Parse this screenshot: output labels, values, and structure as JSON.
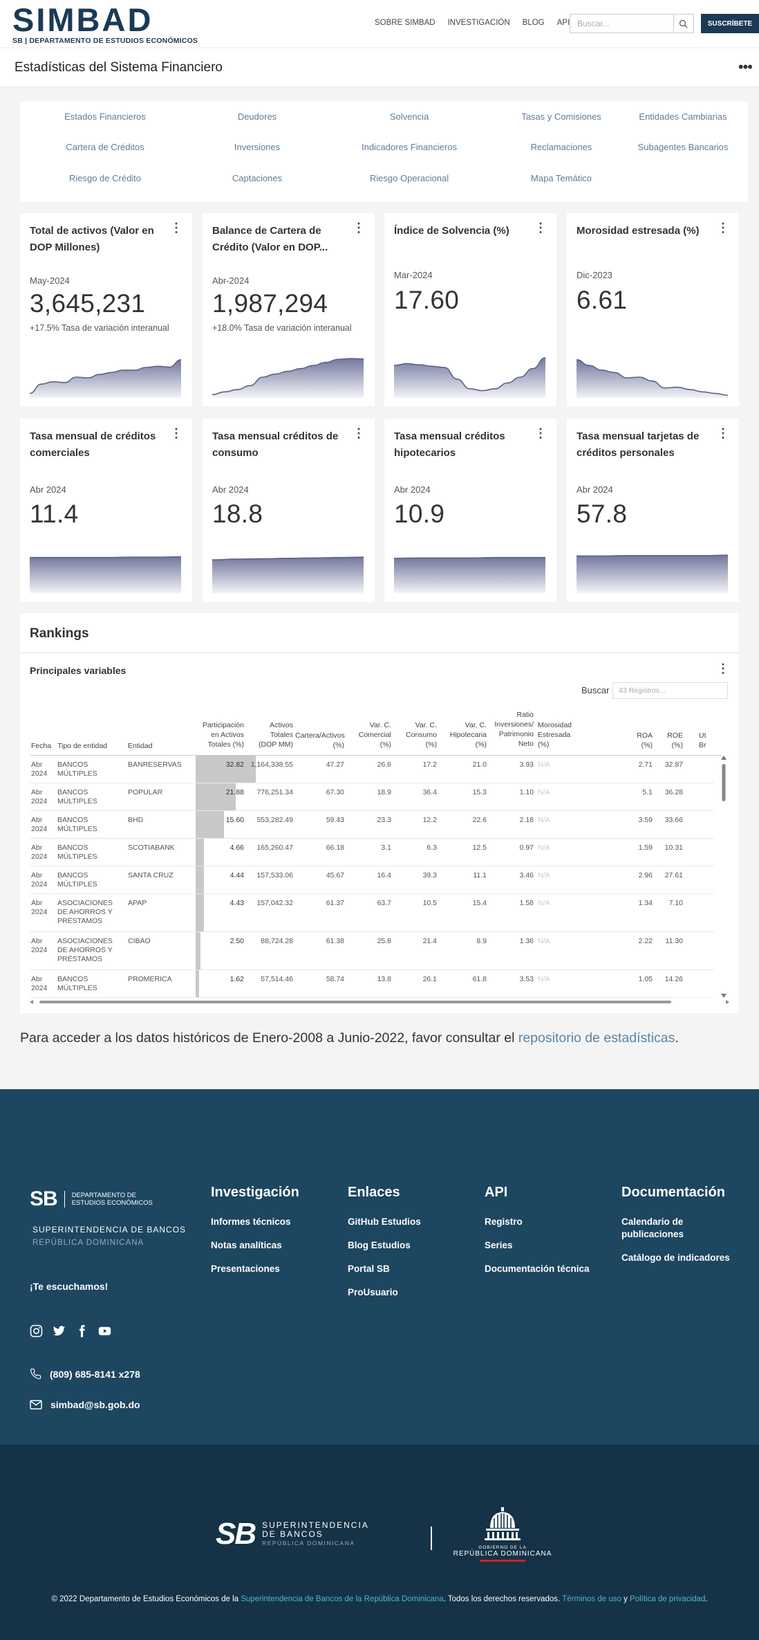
{
  "header": {
    "logo_text": "SIMBAD",
    "logo_mark": "SB",
    "logo_sub": "DEPARTAMENTO DE ESTUDIOS ECONÓMICOS",
    "nav": [
      "SOBRE SIMBAD",
      "INVESTIGACIÓN",
      "BLOG",
      "API"
    ],
    "search_placeholder": "Buscar...",
    "subscribe_label": "SUSCRÍBETE"
  },
  "page": {
    "title": "Estadísticas del Sistema Financiero",
    "more_icon": "more-dots-icon"
  },
  "categories": [
    "Estados Financieros",
    "Deudores",
    "Solvencia",
    "Tasas y Comisiones",
    "Entidades Cambiarias",
    "Cartera de Créditos",
    "Inversiones",
    "Indicadores Financieros",
    "Reclamaciones",
    "Subagentes Bancarios",
    "Riesgo de Crédito",
    "Captaciones",
    "Riesgo Operacional",
    "Mapa Temático"
  ],
  "cards_row1": [
    {
      "title": "Total de activos (Valor en DOP Millones)",
      "date": "May-2024",
      "value": "3,645,231",
      "sub": "+17.5% Tasa de variación interanual",
      "trend": [
        0.08,
        0.32,
        0.38,
        0.36,
        0.5,
        0.48,
        0.57,
        0.62,
        0.68,
        0.68,
        0.75,
        0.78,
        0.76,
        0.95
      ]
    },
    {
      "title": "Balance de Cartera de Crédito (Valor en DOP...",
      "date": "Abr-2024",
      "value": "1,987,294",
      "sub": "+18.0% Tasa de variación interanual",
      "trend": [
        0.05,
        0.12,
        0.18,
        0.28,
        0.5,
        0.58,
        0.65,
        0.72,
        0.8,
        0.88,
        0.96,
        0.98,
        0.97
      ]
    },
    {
      "title": "Índice de Solvencia (%)",
      "date": "Mar-2024",
      "value": "17.60",
      "sub": "",
      "trend": [
        0.8,
        0.85,
        0.82,
        0.78,
        0.75,
        0.45,
        0.2,
        0.15,
        0.2,
        0.35,
        0.5,
        0.72,
        1.0
      ]
    },
    {
      "title": "Morosidad estresada (%)",
      "date": "Dic-2023",
      "value": "6.61",
      "sub": "",
      "trend": [
        0.95,
        0.8,
        0.68,
        0.62,
        0.48,
        0.5,
        0.4,
        0.22,
        0.24,
        0.18,
        0.12,
        0.08,
        0.03
      ]
    }
  ],
  "cards_row2": [
    {
      "title": "Tasa mensual de créditos comerciales",
      "date": "Abr 2024",
      "value": "11.4",
      "trend": [
        0.88,
        0.88,
        0.88,
        0.88,
        0.89,
        0.89,
        0.9
      ]
    },
    {
      "title": "Tasa mensual créditos de consumo",
      "date": "Abr 2024",
      "value": "18.8",
      "trend": [
        0.82,
        0.84,
        0.85,
        0.86,
        0.87,
        0.88,
        0.89
      ]
    },
    {
      "title": "Tasa mensual créditos hipotecarios",
      "date": "Abr 2024",
      "value": "10.9",
      "trend": [
        0.86,
        0.87,
        0.87,
        0.87,
        0.88,
        0.88,
        0.88
      ]
    },
    {
      "title": "Tasa mensual tarjetas de créditos personales",
      "date": "Abr 2024",
      "value": "57.8",
      "trend": [
        0.92,
        0.92,
        0.93,
        0.93,
        0.93,
        0.93,
        0.94
      ]
    }
  ],
  "rankings": {
    "title": "Rankings",
    "subtitle": "Principales variables",
    "search_label": "Buscar",
    "search_placeholder": "43 Registros...",
    "columns": [
      "Fecha",
      "Tipo de entidad",
      "Entidad",
      "Participación en Activos Totales (%)",
      "Activos Totales (DOP MM)",
      "Cartera/Activos (%)",
      "Var. C. Comercial (%)",
      "Var. C. Consumo (%)",
      "Var. C. Hipotecaria (%)",
      "Ratio Inversiones/ Patrimonio Neto",
      "Morosidad Estresada (%)",
      "ROA (%)",
      "ROE (%)",
      "Ut Br"
    ],
    "rows": [
      {
        "fecha": [
          "Abr",
          "2024"
        ],
        "tipo": [
          "BANCOS",
          "MÚLTIPLES"
        ],
        "entidad": "BANRESERVAS",
        "part": "32.82",
        "part_frac": 1.0,
        "activos": "1,164,338.55",
        "cartera": "47.27",
        "com": "26.6",
        "cons": "17.2",
        "hip": "21.0",
        "ratio": "3.93",
        "mor": "N/A",
        "roa": "2.71",
        "roe": "32.87"
      },
      {
        "fecha": [
          "Abr",
          "2024"
        ],
        "tipo": [
          "BANCOS",
          "MÚLTIPLES"
        ],
        "entidad": "POPULAR",
        "part": "21.88",
        "part_frac": 0.667,
        "activos": "776,251.34",
        "cartera": "67.30",
        "com": "18.9",
        "cons": "36.4",
        "hip": "15.3",
        "ratio": "1.10",
        "mor": "N/A",
        "roa": "5.1",
        "roe": "36.28"
      },
      {
        "fecha": [
          "Abr",
          "2024"
        ],
        "tipo": [
          "BANCOS",
          "MÚLTIPLES"
        ],
        "entidad": "BHD",
        "part": "15.60",
        "part_frac": 0.475,
        "activos": "553,282.49",
        "cartera": "59.43",
        "com": "23.3",
        "cons": "12.2",
        "hip": "22.6",
        "ratio": "2.18",
        "mor": "N/A",
        "roa": "3.59",
        "roe": "33.66"
      },
      {
        "fecha": [
          "Abr",
          "2024"
        ],
        "tipo": [
          "BANCOS",
          "MÚLTIPLES"
        ],
        "entidad": "SCOTIABANK",
        "part": "4.66",
        "part_frac": 0.142,
        "activos": "165,260.47",
        "cartera": "66.18",
        "com": "3.1",
        "cons": "6.3",
        "hip": "12.5",
        "ratio": "0.97",
        "mor": "N/A",
        "roa": "1.59",
        "roe": "10.31"
      },
      {
        "fecha": [
          "Abr",
          "2024"
        ],
        "tipo": [
          "BANCOS",
          "MÚLTIPLES"
        ],
        "entidad": "SANTA CRUZ",
        "part": "4.44",
        "part_frac": 0.135,
        "activos": "157,533.06",
        "cartera": "45.67",
        "com": "16.4",
        "cons": "39.3",
        "hip": "11.1",
        "ratio": "3.46",
        "mor": "N/A",
        "roa": "2.96",
        "roe": "27.61"
      },
      {
        "fecha": [
          "Abr",
          "2024"
        ],
        "tipo": [
          "ASOCIACIONES",
          "DE AHORROS Y",
          "PRÉSTAMOS"
        ],
        "entidad": "APAP",
        "part": "4.43",
        "part_frac": 0.135,
        "activos": "157,042.32",
        "cartera": "61.37",
        "com": "63.7",
        "cons": "10.5",
        "hip": "15.4",
        "ratio": "1.58",
        "mor": "N/A",
        "roa": "1.34",
        "roe": "7.10"
      },
      {
        "fecha": [
          "Abr",
          "2024"
        ],
        "tipo": [
          "ASOCIACIONES",
          "DE AHORROS Y",
          "PRÉSTAMOS"
        ],
        "entidad": "CIBAO",
        "part": "2.50",
        "part_frac": 0.076,
        "activos": "88,724.28",
        "cartera": "61.38",
        "com": "25.8",
        "cons": "21.4",
        "hip": "8.9",
        "ratio": "1.36",
        "mor": "N/A",
        "roa": "2.22",
        "roe": "11.30"
      },
      {
        "fecha": [
          "Abr",
          "2024"
        ],
        "tipo": [
          "BANCOS",
          "MÚLTIPLES"
        ],
        "entidad": "PROMERICA",
        "part": "1.62",
        "part_frac": 0.049,
        "activos": "57,514.46",
        "cartera": "58.74",
        "com": "13.8",
        "cons": "26.1",
        "hip": "61.8",
        "ratio": "3.53",
        "mor": "N/A",
        "roa": "1.05",
        "roe": "14.26"
      }
    ]
  },
  "note": {
    "text": "Para acceder a los datos históricos de Enero-2008 a Junio-2022, favor consultar el ",
    "link": "repositorio de estadísticas",
    "end": "."
  },
  "footer": {
    "brand_mark": "SB",
    "brand_right": "DEPARTAMENTO DE ESTUDIOS ECONÓMICOS",
    "super_line1": "SUPERINTENDENCIA DE BANCOS",
    "super_line2": "REPÚBLICA DOMINICANA",
    "listen": "¡Te escuchamos!",
    "phone": "(809) 685-8141 x278",
    "email": "simbad@sb.gob.do",
    "cols": [
      {
        "title": "Investigación",
        "links": [
          "Informes técnicos",
          "Notas analíticas",
          "Presentaciones"
        ]
      },
      {
        "title": "Enlaces",
        "links": [
          "GitHub Estudios",
          "Blog Estudios",
          "Portal SB",
          "ProUsuario"
        ]
      },
      {
        "title": "API",
        "links": [
          "Registro",
          "Series",
          "Documentación técnica"
        ]
      },
      {
        "title": "Documentación",
        "links": [
          "Calendario de publicaciones",
          "Catálogo de indicadores"
        ]
      }
    ],
    "sb_big": "SB",
    "sb_line1": "SUPERINTENDENCIA",
    "sb_line2": "DE BANCOS",
    "sb_line3": "REPÚBLICA DOMINICANA",
    "gov_small": "GOBIERNO DE LA",
    "gov_big": "REPÚBLICA DOMINICANA",
    "copy_a": "© 2022 Departamento de Estudios Económicos de la ",
    "copy_link1": "Superintendencia de Bancos de la República Dominicana",
    "copy_b": ". Todos los derechos reservados. ",
    "copy_link2": "Términos de uso",
    "copy_c": " y ",
    "copy_link3": "Política de privacidad",
    "copy_d": "."
  },
  "colors": {
    "brand": "#1b3a55",
    "footer": "#1d4660",
    "footer_dark": "#153246",
    "link": "#5b84a5",
    "accent_link": "#4fb5d6",
    "spark": "#5c6289"
  }
}
